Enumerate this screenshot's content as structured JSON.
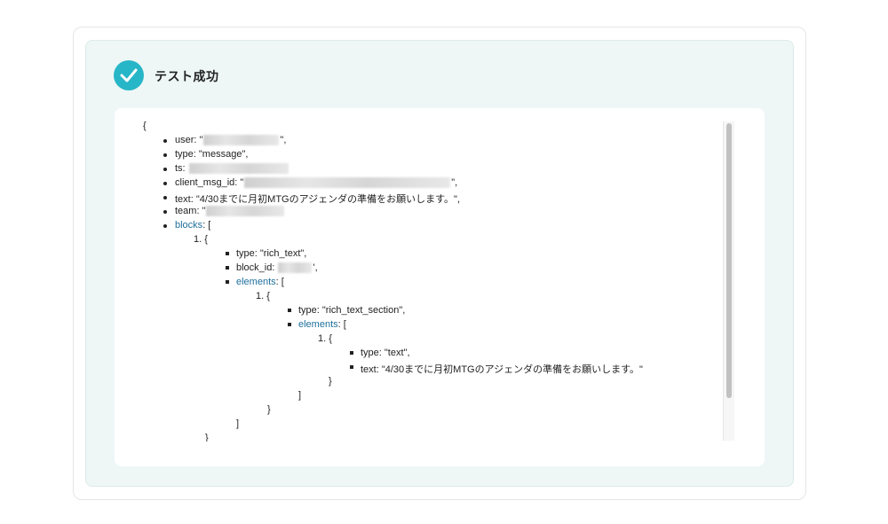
{
  "header": {
    "title": "テスト成功"
  },
  "output": {
    "open_brace": "{",
    "top_fields": [
      {
        "label": "user: ",
        "value": "\"",
        "suffix": "\","
      },
      {
        "label": "type: ",
        "value": "\"message\",",
        "suffix": ""
      },
      {
        "label": "ts: ",
        "value": "",
        "suffix": ""
      },
      {
        "label": "client_msg_id: ",
        "value": "\"",
        "suffix": "\","
      },
      {
        "label": "text: ",
        "value": "\"4/30までに月初MTGのアジェンダの準備をお願いします。\",",
        "suffix": ""
      },
      {
        "label": "team: ",
        "value": "\"",
        "suffix": ""
      }
    ],
    "blocks": {
      "key": "blocks",
      "open": ": [",
      "item_index": "1. {",
      "type_line": "type: \"rich_text\",",
      "block_id_label": "block_id: ",
      "block_id_suffix": "',",
      "elements_key": "elements",
      "elements_open": ": [",
      "elements_item_index": "1. {",
      "section_type_line": "type: \"rich_text_section\",",
      "inner_elements_key": "elements",
      "inner_elements_open": ": [",
      "inner_item_index": "1. {",
      "inner_type_line": "type: \"text\",",
      "inner_text_line": "text: \"4/30までに月初MTGのアジェンダの準備をお願いします。\"",
      "close_brace_1": "}",
      "close_bracket_1": "]",
      "close_brace_2": "}",
      "close_bracket_2": "]",
      "close_brace_3": "}"
    }
  },
  "colors": {
    "accent": "#27b6c7",
    "panel_bg": "#eef7f6",
    "link_key": "#1f6f9c"
  }
}
